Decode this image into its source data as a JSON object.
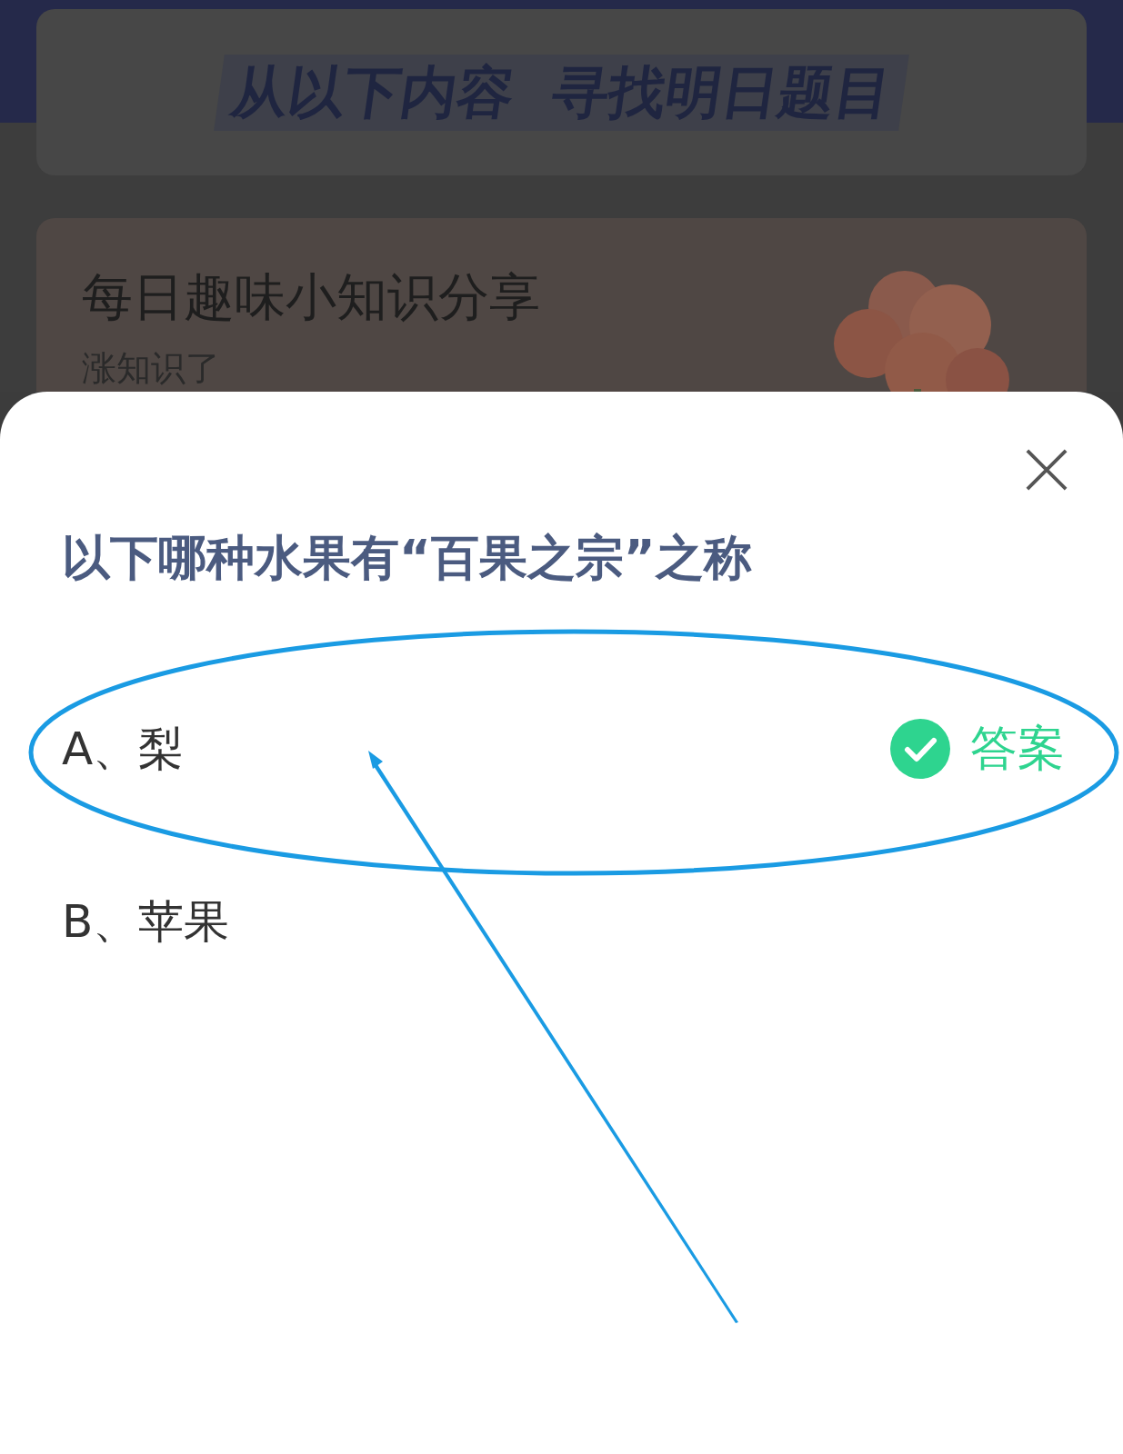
{
  "banner": {
    "title": "从以下内容  寻找明日题目"
  },
  "card": {
    "title": "每日趣味小知识分享",
    "subtitle": "涨知识了"
  },
  "quiz": {
    "question": "以下哪种水果有“百果之宗”之称",
    "answer_label": "答案",
    "options": [
      {
        "label": "A、梨",
        "correct": true
      },
      {
        "label": "B、苹果",
        "correct": false
      }
    ]
  }
}
